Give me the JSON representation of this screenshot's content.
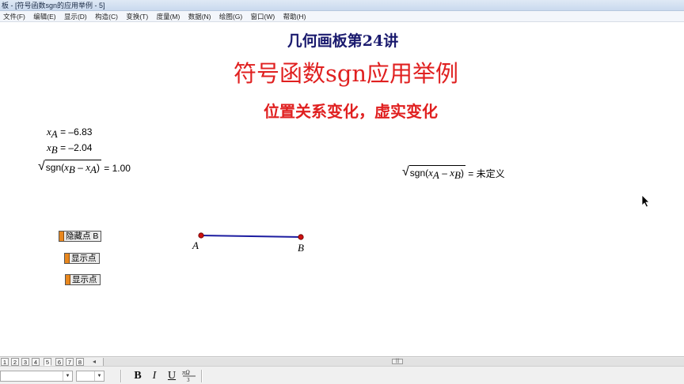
{
  "window": {
    "title": "板 - [符号函数sgn的应用举例 - 5]"
  },
  "menu": [
    {
      "label": "文件(F)"
    },
    {
      "label": "编辑(E)"
    },
    {
      "label": "显示(D)"
    },
    {
      "label": "构造(C)"
    },
    {
      "label": "变换(T)"
    },
    {
      "label": "度量(M)"
    },
    {
      "label": "数据(N)"
    },
    {
      "label": "绘图(G)"
    },
    {
      "label": "窗口(W)"
    },
    {
      "label": "帮助(H)"
    }
  ],
  "document": {
    "title_main": "几何画板第24讲",
    "title_sub": "符号函数sgn应用举例",
    "title_desc": "位置关系变化，虚实变化"
  },
  "measurements": {
    "xa": {
      "var": "x",
      "sub": "A",
      "eq": " = –6.83"
    },
    "xb": {
      "var": "x",
      "sub": "B",
      "eq": " = –2.04"
    },
    "sqrt_left": {
      "fn": "sgn",
      "v1": "x",
      "s1": "B",
      "op": " – ",
      "v2": "x",
      "s2": "A",
      "eq": " = 1.00"
    },
    "sqrt_right": {
      "fn": "sgn",
      "v1": "x",
      "s1": "A",
      "op": " – ",
      "v2": "x",
      "s2": "B",
      "eq": " = 未定义"
    }
  },
  "buttons": {
    "hide_point_b": "隐藏点 B",
    "show_point_1": "显示点",
    "show_point_2": "显示点"
  },
  "points": {
    "a_label": "A",
    "b_label": "B",
    "color": "#cc1111",
    "segment_color": "#1c1ca0"
  },
  "pages": [
    "1",
    "2",
    "3",
    "4",
    "5",
    "6",
    "7",
    "8"
  ],
  "active_page": "5",
  "scroll_thumb": "|||",
  "toolbar": {
    "bold": "B",
    "italic": "I",
    "underline": "U"
  },
  "colors": {
    "title_blue": "#1a1a6e",
    "title_red": "#e02020",
    "button_accent": "#e8871e"
  }
}
